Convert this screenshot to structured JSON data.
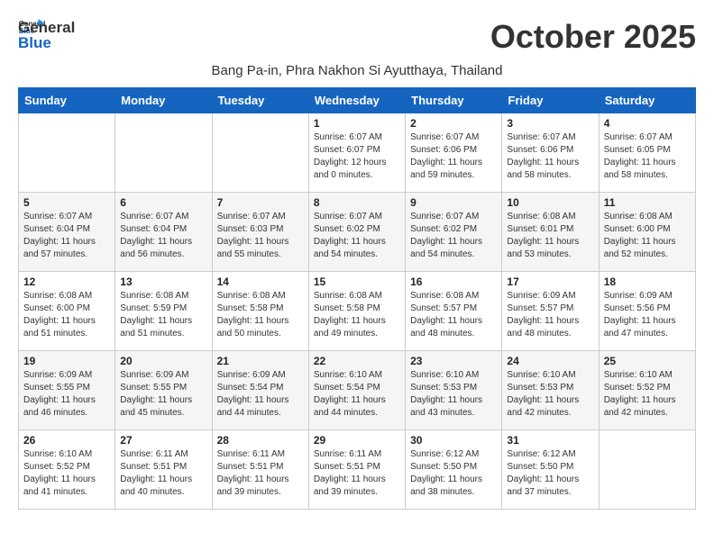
{
  "header": {
    "logo_general": "General",
    "logo_blue": "Blue",
    "month_title": "October 2025",
    "subtitle": "Bang Pa-in, Phra Nakhon Si Ayutthaya, Thailand"
  },
  "weekdays": [
    "Sunday",
    "Monday",
    "Tuesday",
    "Wednesday",
    "Thursday",
    "Friday",
    "Saturday"
  ],
  "weeks": [
    [
      {
        "day": "",
        "content": ""
      },
      {
        "day": "",
        "content": ""
      },
      {
        "day": "",
        "content": ""
      },
      {
        "day": "1",
        "content": "Sunrise: 6:07 AM\nSunset: 6:07 PM\nDaylight: 12 hours\nand 0 minutes."
      },
      {
        "day": "2",
        "content": "Sunrise: 6:07 AM\nSunset: 6:06 PM\nDaylight: 11 hours\nand 59 minutes."
      },
      {
        "day": "3",
        "content": "Sunrise: 6:07 AM\nSunset: 6:06 PM\nDaylight: 11 hours\nand 58 minutes."
      },
      {
        "day": "4",
        "content": "Sunrise: 6:07 AM\nSunset: 6:05 PM\nDaylight: 11 hours\nand 58 minutes."
      }
    ],
    [
      {
        "day": "5",
        "content": "Sunrise: 6:07 AM\nSunset: 6:04 PM\nDaylight: 11 hours\nand 57 minutes."
      },
      {
        "day": "6",
        "content": "Sunrise: 6:07 AM\nSunset: 6:04 PM\nDaylight: 11 hours\nand 56 minutes."
      },
      {
        "day": "7",
        "content": "Sunrise: 6:07 AM\nSunset: 6:03 PM\nDaylight: 11 hours\nand 55 minutes."
      },
      {
        "day": "8",
        "content": "Sunrise: 6:07 AM\nSunset: 6:02 PM\nDaylight: 11 hours\nand 54 minutes."
      },
      {
        "day": "9",
        "content": "Sunrise: 6:07 AM\nSunset: 6:02 PM\nDaylight: 11 hours\nand 54 minutes."
      },
      {
        "day": "10",
        "content": "Sunrise: 6:08 AM\nSunset: 6:01 PM\nDaylight: 11 hours\nand 53 minutes."
      },
      {
        "day": "11",
        "content": "Sunrise: 6:08 AM\nSunset: 6:00 PM\nDaylight: 11 hours\nand 52 minutes."
      }
    ],
    [
      {
        "day": "12",
        "content": "Sunrise: 6:08 AM\nSunset: 6:00 PM\nDaylight: 11 hours\nand 51 minutes."
      },
      {
        "day": "13",
        "content": "Sunrise: 6:08 AM\nSunset: 5:59 PM\nDaylight: 11 hours\nand 51 minutes."
      },
      {
        "day": "14",
        "content": "Sunrise: 6:08 AM\nSunset: 5:58 PM\nDaylight: 11 hours\nand 50 minutes."
      },
      {
        "day": "15",
        "content": "Sunrise: 6:08 AM\nSunset: 5:58 PM\nDaylight: 11 hours\nand 49 minutes."
      },
      {
        "day": "16",
        "content": "Sunrise: 6:08 AM\nSunset: 5:57 PM\nDaylight: 11 hours\nand 48 minutes."
      },
      {
        "day": "17",
        "content": "Sunrise: 6:09 AM\nSunset: 5:57 PM\nDaylight: 11 hours\nand 48 minutes."
      },
      {
        "day": "18",
        "content": "Sunrise: 6:09 AM\nSunset: 5:56 PM\nDaylight: 11 hours\nand 47 minutes."
      }
    ],
    [
      {
        "day": "19",
        "content": "Sunrise: 6:09 AM\nSunset: 5:55 PM\nDaylight: 11 hours\nand 46 minutes."
      },
      {
        "day": "20",
        "content": "Sunrise: 6:09 AM\nSunset: 5:55 PM\nDaylight: 11 hours\nand 45 minutes."
      },
      {
        "day": "21",
        "content": "Sunrise: 6:09 AM\nSunset: 5:54 PM\nDaylight: 11 hours\nand 44 minutes."
      },
      {
        "day": "22",
        "content": "Sunrise: 6:10 AM\nSunset: 5:54 PM\nDaylight: 11 hours\nand 44 minutes."
      },
      {
        "day": "23",
        "content": "Sunrise: 6:10 AM\nSunset: 5:53 PM\nDaylight: 11 hours\nand 43 minutes."
      },
      {
        "day": "24",
        "content": "Sunrise: 6:10 AM\nSunset: 5:53 PM\nDaylight: 11 hours\nand 42 minutes."
      },
      {
        "day": "25",
        "content": "Sunrise: 6:10 AM\nSunset: 5:52 PM\nDaylight: 11 hours\nand 42 minutes."
      }
    ],
    [
      {
        "day": "26",
        "content": "Sunrise: 6:10 AM\nSunset: 5:52 PM\nDaylight: 11 hours\nand 41 minutes."
      },
      {
        "day": "27",
        "content": "Sunrise: 6:11 AM\nSunset: 5:51 PM\nDaylight: 11 hours\nand 40 minutes."
      },
      {
        "day": "28",
        "content": "Sunrise: 6:11 AM\nSunset: 5:51 PM\nDaylight: 11 hours\nand 39 minutes."
      },
      {
        "day": "29",
        "content": "Sunrise: 6:11 AM\nSunset: 5:51 PM\nDaylight: 11 hours\nand 39 minutes."
      },
      {
        "day": "30",
        "content": "Sunrise: 6:12 AM\nSunset: 5:50 PM\nDaylight: 11 hours\nand 38 minutes."
      },
      {
        "day": "31",
        "content": "Sunrise: 6:12 AM\nSunset: 5:50 PM\nDaylight: 11 hours\nand 37 minutes."
      },
      {
        "day": "",
        "content": ""
      }
    ]
  ]
}
